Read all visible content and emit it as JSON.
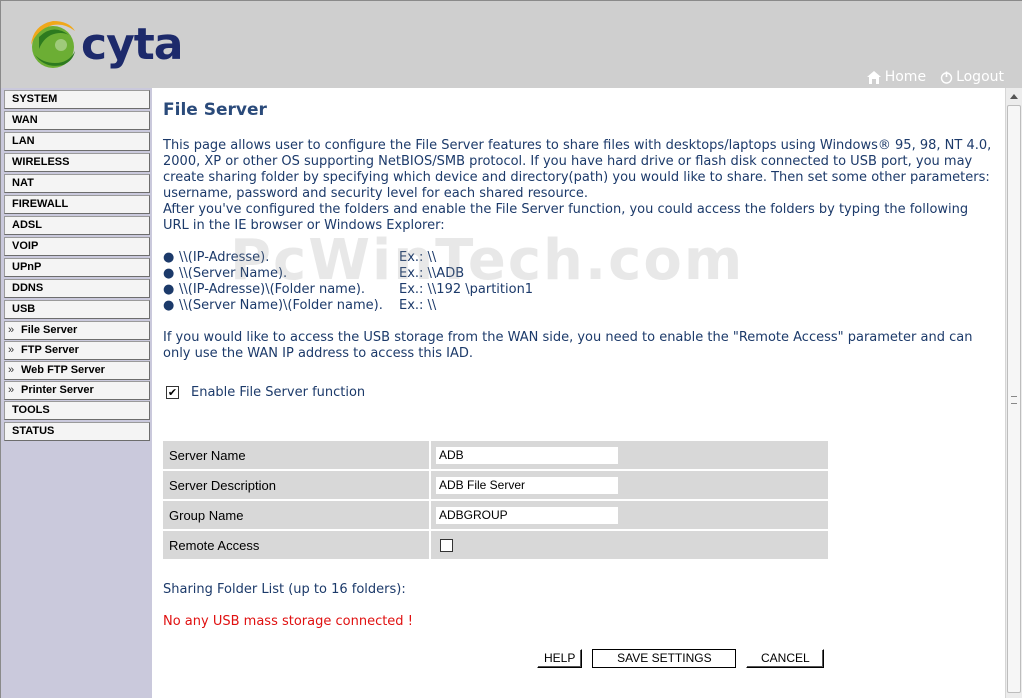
{
  "header": {
    "logo_text": "cyta",
    "home_label": "Home",
    "logout_label": "Logout"
  },
  "sidebar": {
    "items": [
      {
        "label": "SYSTEM"
      },
      {
        "label": "WAN"
      },
      {
        "label": "LAN"
      },
      {
        "label": "WIRELESS"
      },
      {
        "label": "NAT"
      },
      {
        "label": "FIREWALL"
      },
      {
        "label": "ADSL"
      },
      {
        "label": "VOIP"
      },
      {
        "label": "UPnP"
      },
      {
        "label": "DDNS"
      },
      {
        "label": "USB"
      },
      {
        "label": "File Server"
      },
      {
        "label": "FTP Server"
      },
      {
        "label": "Web FTP Server"
      },
      {
        "label": "Printer Server"
      },
      {
        "label": "TOOLS"
      },
      {
        "label": "STATUS"
      }
    ],
    "sub_arrow": "»"
  },
  "main": {
    "title": "File Server",
    "intro_1": "This page allows user to configure the File Server features to share files with desktops/laptops using Windows® 95, 98, NT 4.0, 2000, XP or other OS supporting NetBIOS/SMB protocol. If you have hard drive or flash disk connected to USB port, you may create sharing folder by specifying which device and directory(path) you would like to share. Then set some other parameters: username, password and security level for each shared resource.",
    "intro_2": "After you've configured the folders and enable the File Server function, you could access the folders by typing the following URL in the IE browser or Windows Explorer:",
    "bullets": [
      {
        "path": "\\\\(IP-Adresse).",
        "example": "Ex.: \\\\"
      },
      {
        "path": "\\\\(Server Name).",
        "example": "Ex.: \\\\ADB"
      },
      {
        "path": "\\\\(IP-Adresse)\\(Folder name).",
        "example": "Ex.: \\\\192              \\partition1"
      },
      {
        "path": "\\\\(Server Name)\\(Folder name).",
        "example": "Ex.: \\\\"
      }
    ],
    "wan_note": "If you would like to access the USB storage from the WAN side, you need to enable the \"Remote Access\" parameter and can only use the WAN IP address to access this IAD.",
    "watermark": "PcWinTech.com",
    "enable_label": "Enable File Server function",
    "enable_checked": true,
    "fields": [
      {
        "label": "Server Name",
        "value": "ADB"
      },
      {
        "label": "Server Description",
        "value": "ADB File Server"
      },
      {
        "label": "Group Name",
        "value": "ADBGROUP"
      }
    ],
    "remote_access_label": "Remote Access",
    "remote_access_checked": false,
    "sharing_label": "Sharing Folder List (up to 16 folders):",
    "no_storage_msg": "No any USB mass storage connected !",
    "buttons": {
      "help": "HELP",
      "save": "SAVE SETTINGS",
      "cancel": "CANCEL"
    }
  },
  "colors": {
    "header_bg": "#cfcfcf",
    "sidebar_bg": "#cac9dc",
    "title": "#2a4a7a",
    "body_text": "#1c3a6a",
    "error": "#e01010",
    "logo_text": "#1d2a6b"
  }
}
